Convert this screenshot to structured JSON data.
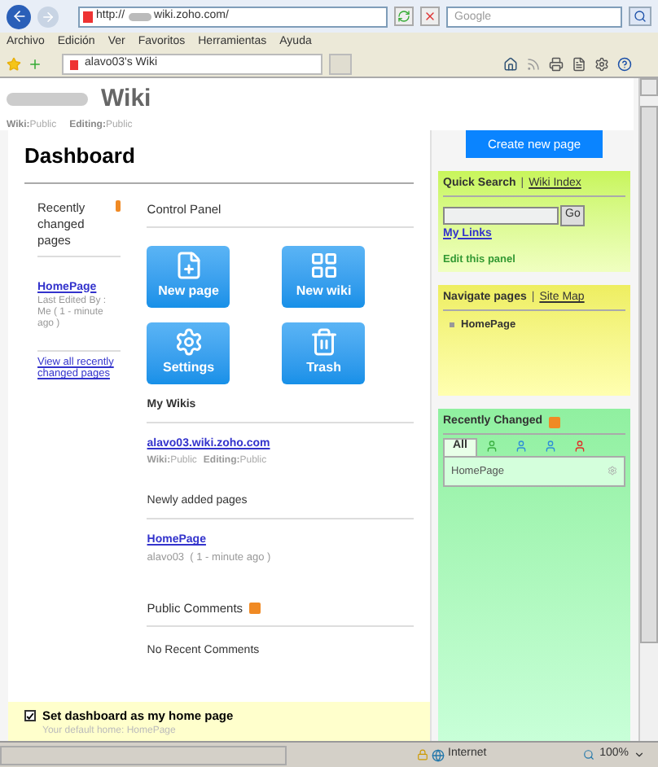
{
  "browser": {
    "url_scheme": "http://",
    "url_host": "wiki.zoho.com/",
    "search_placeholder": "Google",
    "menu": [
      "Archivo",
      "Edición",
      "Ver",
      "Favoritos",
      "Herramientas",
      "Ayuda"
    ],
    "tab_title": "alavo03's Wiki"
  },
  "header": {
    "title": "Wiki",
    "meta": [
      {
        "label": "Wiki:",
        "value": "Public"
      },
      {
        "label": "Editing:",
        "value": "Public"
      }
    ]
  },
  "dashboard": {
    "title": "Dashboard",
    "recent": {
      "heading": "Recently changed pages",
      "items": [
        {
          "page": "HomePage",
          "info": "Last Edited By : Me ( 1 - minute ago )"
        }
      ],
      "view_all": "View all recently changed pages"
    },
    "control_panel": {
      "heading": "Control Panel",
      "buttons": [
        {
          "label": "New page",
          "kind": "page"
        },
        {
          "label": "New wiki",
          "kind": "wiki"
        },
        {
          "label": "Settings",
          "kind": "settings"
        },
        {
          "label": "Trash",
          "kind": "trash"
        }
      ]
    },
    "my_wikis": {
      "heading": "My Wikis",
      "items": [
        {
          "name": "alavo03.wiki.zoho.com",
          "meta": [
            {
              "label": "Wiki:",
              "value": "Public"
            },
            {
              "label": "Editing:",
              "value": "Public"
            }
          ]
        }
      ]
    },
    "newly_added": {
      "heading": "Newly added pages",
      "items": [
        {
          "page": "HomePage",
          "info": "alavo03  ( 1 - minute ago )"
        }
      ]
    },
    "public_comments": {
      "heading": "Public Comments",
      "empty": "No Recent Comments"
    }
  },
  "home_option": {
    "checked": true,
    "label": "Set dashboard as my home page",
    "hint": "Your default home: HomePage"
  },
  "sidebar": {
    "create_button": "Create new page",
    "quick_search": {
      "title": "Quick Search",
      "separator": "|",
      "link": "Wiki Index",
      "go": "Go",
      "my_links": "My Links",
      "edit": "Edit this panel"
    },
    "navigate": {
      "title": "Navigate pages",
      "separator": "|",
      "link": "Site Map",
      "items": [
        "HomePage"
      ]
    },
    "recently_changed": {
      "title": "Recently Changed",
      "tabs": [
        {
          "kind": "text",
          "label": "All",
          "selected": true
        },
        {
          "kind": "user",
          "color": "#3cb043",
          "selected": false
        },
        {
          "kind": "user",
          "color": "#2f8fd8",
          "selected": false
        },
        {
          "kind": "user",
          "color": "#2f8fd8",
          "selected": false
        },
        {
          "kind": "user",
          "color": "#e0302a",
          "selected": false
        }
      ],
      "items": [
        "HomePage"
      ]
    }
  },
  "status": {
    "zone": "Internet",
    "zoom": "100%"
  }
}
